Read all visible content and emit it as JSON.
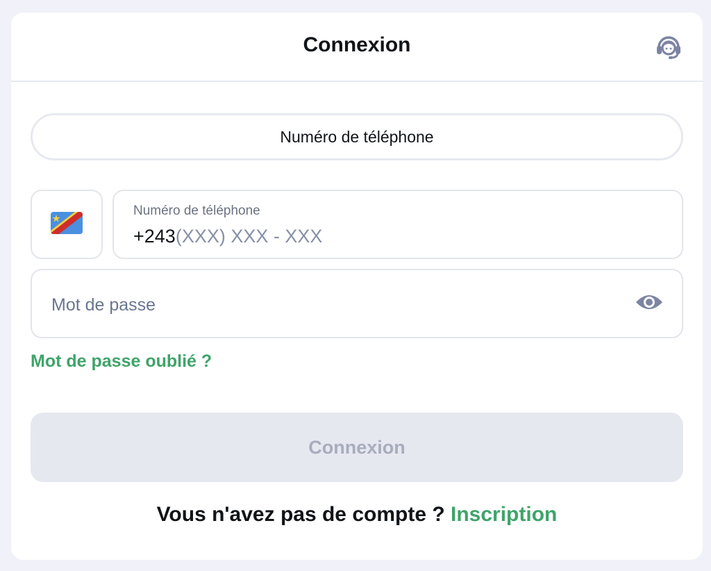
{
  "header": {
    "title": "Connexion",
    "support_icon": "headset-support-icon"
  },
  "login_method": {
    "label": "Numéro de téléphone"
  },
  "country": {
    "flag_icon": "drc-flag-icon",
    "flag_colors": {
      "field": "#4a8fe0",
      "stripe": "#cf2d2d",
      "edge": "#f2d13c",
      "star": "#f2d13c"
    }
  },
  "phone": {
    "label": "Numéro de téléphone",
    "prefix": "+243",
    "mask": "(XXX) XXX - XXX"
  },
  "password": {
    "placeholder": "Mot de passe",
    "toggle_icon": "eye-icon"
  },
  "forgot_password": "Mot de passe oublié ?",
  "submit": {
    "label": "Connexion",
    "enabled": false
  },
  "signup": {
    "question": "Vous n'avez pas de compte ?",
    "link": "Inscription"
  },
  "colors": {
    "accent_green": "#3fa46a",
    "background": "#f1f2f9",
    "disabled_button": "#e6e8f0",
    "icon_gray": "#7c84a3"
  }
}
